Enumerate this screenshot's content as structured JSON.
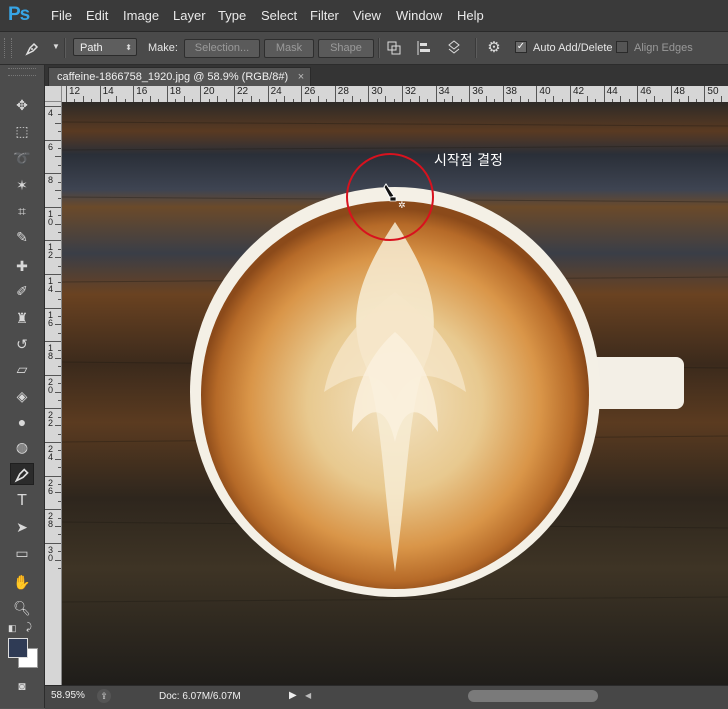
{
  "app": {
    "logo": "Ps"
  },
  "menu": [
    "File",
    "Edit",
    "Image",
    "Layer",
    "Type",
    "Select",
    "Filter",
    "View",
    "Window",
    "Help"
  ],
  "options": {
    "tool_icon": "pen-icon",
    "mode_value": "Path",
    "make_label": "Make:",
    "selection_label": "Selection...",
    "mask_label": "Mask",
    "shape_label": "Shape",
    "auto_add_delete_label": "Auto Add/Delete",
    "auto_add_delete_checked": true,
    "align_edges_label": "Align Edges",
    "align_edges_checked": false
  },
  "document_tab": {
    "title": "caffeine-1866758_1920.jpg @ 58.9% (RGB/8#)",
    "close": "×"
  },
  "rulers": {
    "top": [
      "12",
      "14",
      "16",
      "18",
      "20",
      "22",
      "24",
      "26",
      "28",
      "30",
      "32",
      "34",
      "36",
      "38",
      "40",
      "42",
      "44",
      "46",
      "48",
      "50"
    ],
    "left": [
      "4",
      "6",
      "8",
      "10",
      "12",
      "14",
      "16",
      "18",
      "20",
      "22",
      "24",
      "26",
      "28",
      "30"
    ]
  },
  "annotation": {
    "text": "시작점 결정",
    "circle_color": "#d8121e"
  },
  "status": {
    "zoom": "58.95%",
    "doc": "Doc: 6.07M/6.07M"
  },
  "colors": {
    "foreground": "#2f3b55",
    "background": "#ffffff"
  }
}
